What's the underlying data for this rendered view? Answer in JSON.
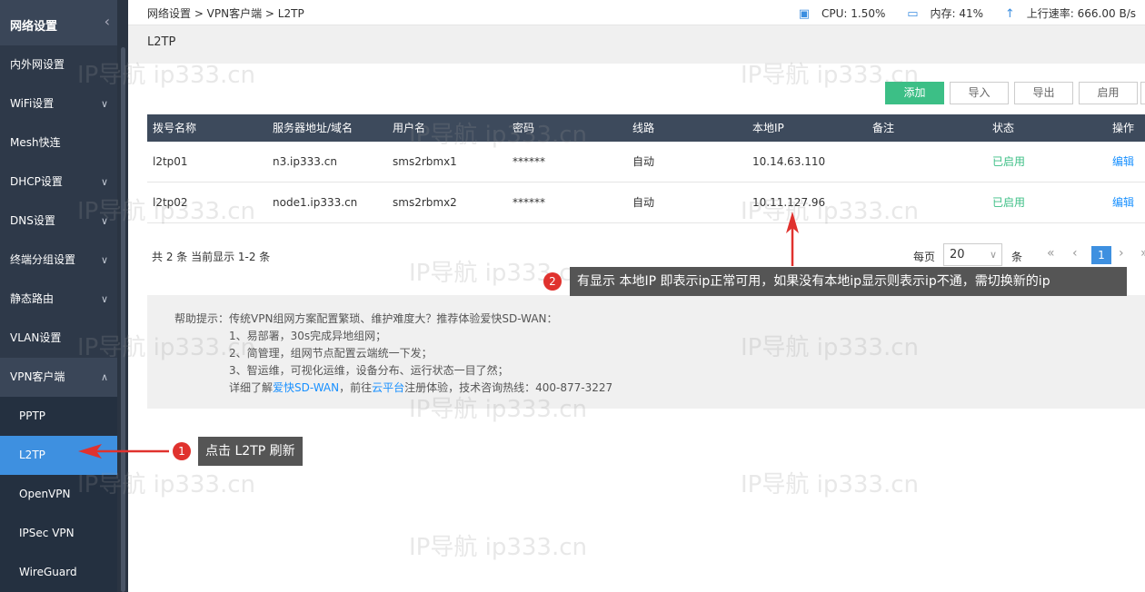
{
  "sidebar": {
    "title": "网络设置",
    "items": [
      {
        "label": "内外网设置",
        "has_arrow": false
      },
      {
        "label": "WiFi设置",
        "has_arrow": true
      },
      {
        "label": "Mesh快连",
        "has_arrow": false
      },
      {
        "label": "DHCP设置",
        "has_arrow": true
      },
      {
        "label": "DNS设置",
        "has_arrow": true
      },
      {
        "label": "终端分组设置",
        "has_arrow": true
      },
      {
        "label": "静态路由",
        "has_arrow": true
      },
      {
        "label": "VLAN设置",
        "has_arrow": false
      },
      {
        "label": "VPN客户端",
        "has_arrow": true,
        "expanded": true
      }
    ],
    "sub_items": [
      {
        "label": "PPTP"
      },
      {
        "label": "L2TP",
        "active": true
      },
      {
        "label": "OpenVPN"
      },
      {
        "label": "IPSec VPN"
      },
      {
        "label": "WireGuard"
      }
    ]
  },
  "header": {
    "breadcrumb": "网络设置 > VPN客户端 > L2TP",
    "cpu": "CPU: 1.50%",
    "memory": "内存: 41%",
    "upload": "上行速率: 666.00 B/s"
  },
  "page_title": "L2TP",
  "toolbar": {
    "add": "添加",
    "import": "导入",
    "export": "导出",
    "enable": "启用"
  },
  "table": {
    "columns": [
      "拨号名称",
      "服务器地址/域名",
      "用户名",
      "密码",
      "线路",
      "本地IP",
      "备注",
      "状态",
      "操作"
    ],
    "rows": [
      {
        "name": "l2tp01",
        "server": "n3.ip333.cn",
        "user": "sms2rbmx1",
        "password": "******",
        "line": "自动",
        "local_ip": "10.14.63.110",
        "note": "",
        "status": "已启用",
        "action": "编辑"
      },
      {
        "name": "l2tp02",
        "server": "node1.ip333.cn",
        "user": "sms2rbmx2",
        "password": "******",
        "line": "自动",
        "local_ip": "10.11.127.96",
        "note": "",
        "status": "已启用",
        "action": "编辑"
      }
    ]
  },
  "pagination": {
    "summary": "共 2 条 当前显示 1-2 条",
    "per_page_label": "每页",
    "per_page_value": "20",
    "per_page_unit": "条",
    "current_page": "1"
  },
  "help": {
    "line1": "帮助提示：传统VPN组网方案配置繁琐、维护难度大？推荐体验爱快SD-WAN：",
    "line2": "1、易部署，30s完成异地组网；",
    "line3": "2、简管理，组网节点配置云端统一下发；",
    "line4": "3、智运维，可视化运维，设备分布、运行状态一目了然；",
    "line5_a": "详细了解",
    "line5_link1": "爱快SD-WAN",
    "line5_b": "，前往",
    "line5_link2": "云平台",
    "line5_c": "注册体验，技术咨询热线：400-877-3227"
  },
  "annotations": {
    "callout1_num": "1",
    "callout1_text": "点击 L2TP 刷新",
    "callout2_num": "2",
    "callout2_text": "有显示 本地IP 即表示ip正常可用，如果没有本地ip显示则表示ip不通，需切换新的ip"
  },
  "watermark": "IP导航  ip333.cn",
  "colors": {
    "accent": "#3e90e0",
    "green": "#3cbf86",
    "sidebar": "#2e3949",
    "header": "#3d4a5c",
    "callout": "#555555",
    "badge": "#e0322e"
  }
}
